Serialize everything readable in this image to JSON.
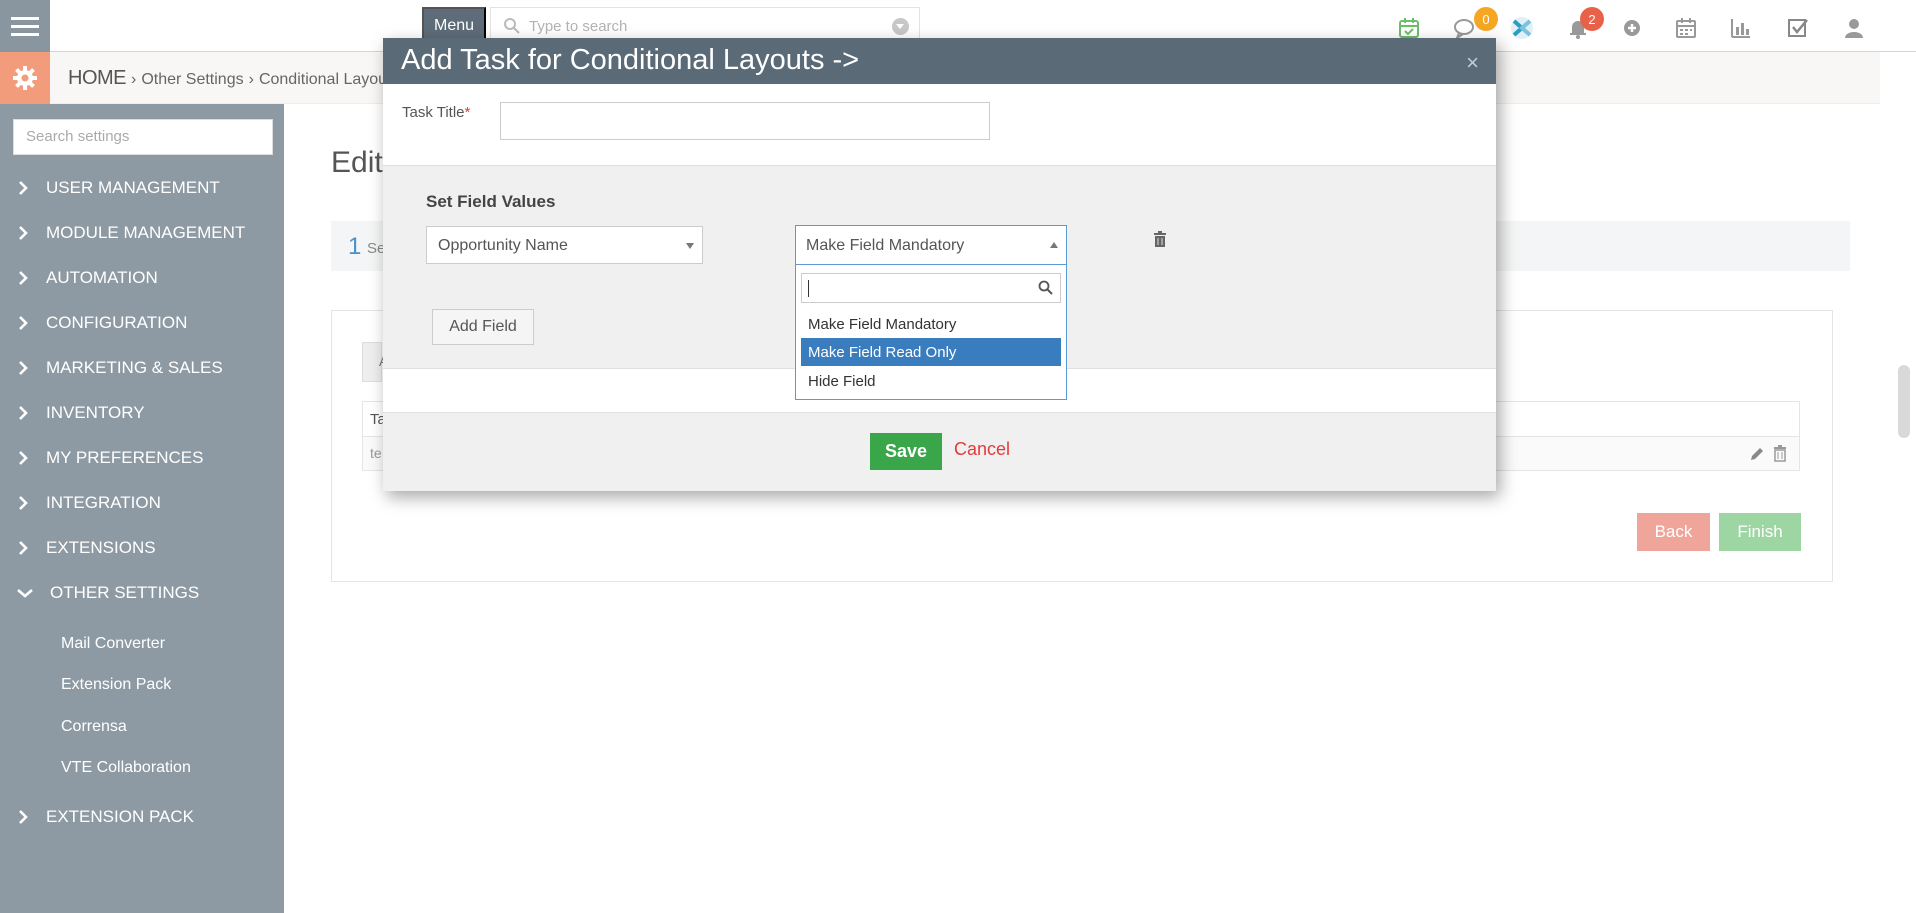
{
  "topbar": {
    "menu_label": "Menu",
    "search_placeholder": "Type to search",
    "chat_badge": "0",
    "notification_badge": "2",
    "colors": {
      "chat_badge": "#f5a623",
      "notification_badge": "#e8624a",
      "menu_bg": "#5e6c79"
    }
  },
  "breadcrumb": {
    "home": "HOME",
    "items": [
      "Other Settings",
      "Conditional Layouts"
    ]
  },
  "sidebar": {
    "search_placeholder": "Search settings",
    "sections": [
      {
        "label": "USER MANAGEMENT",
        "expanded": false
      },
      {
        "label": "MODULE MANAGEMENT",
        "expanded": false
      },
      {
        "label": "AUTOMATION",
        "expanded": false
      },
      {
        "label": "CONFIGURATION",
        "expanded": false
      },
      {
        "label": "MARKETING & SALES",
        "expanded": false
      },
      {
        "label": "INVENTORY",
        "expanded": false
      },
      {
        "label": "MY PREFERENCES",
        "expanded": false
      },
      {
        "label": "INTEGRATION",
        "expanded": false
      },
      {
        "label": "EXTENSIONS",
        "expanded": false
      },
      {
        "label": "OTHER SETTINGS",
        "expanded": true
      },
      {
        "label": "EXTENSION PACK",
        "expanded": false
      }
    ],
    "other_settings_items": [
      "Mail Converter",
      "Extension Pack",
      "Corrensa",
      "VTE Collaboration"
    ]
  },
  "main": {
    "title": "Edit",
    "step_number": "1",
    "step_label": "Se",
    "tab_label": "A",
    "table_header": "Ta",
    "table_row_cell": "te",
    "back_label": "Back",
    "finish_label": "Finish"
  },
  "modal": {
    "title": "Add Task for Conditional Layouts ->",
    "close_label": "×",
    "task_title_label": "Task Title",
    "required_mark": "*",
    "task_title_value": "",
    "set_field_values_label": "Set Field Values",
    "field_select_value": "Opportunity Name",
    "action_select_value": "Make Field Mandatory",
    "dropdown_search_value": "",
    "dropdown_options": [
      "Make Field Mandatory",
      "Make Field Read Only",
      "Hide Field"
    ],
    "dropdown_highlighted": "Make Field Read Only",
    "add_field_label": "Add Field",
    "save_label": "Save",
    "cancel_label": "Cancel"
  }
}
